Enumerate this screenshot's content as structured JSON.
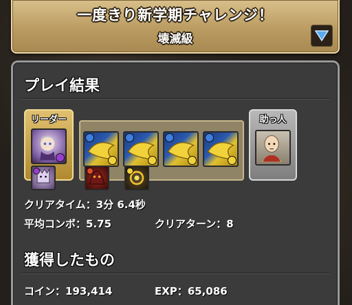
{
  "header": {
    "title": "一度きり新学期チャレンジ！",
    "difficulty": "壊滅級"
  },
  "results": {
    "section_title": "プレイ結果",
    "leader_label": "リーダー",
    "helper_label": "助っ人",
    "clear_time_label": "クリアタイム：",
    "clear_time_value": "3分 6.4秒",
    "avg_combo_label": "平均コンボ：",
    "avg_combo_value": "5.75",
    "clear_turns_label": "クリアターン：",
    "clear_turns_value": "8"
  },
  "rewards": {
    "section_title": "獲得したもの",
    "coin_label": "コイン：",
    "coin_value": "193,414",
    "exp_label": "EXP：",
    "exp_value": "65,086"
  },
  "colors": {
    "banner": "#c4a66e",
    "leader_frame": "#d4b050",
    "helper_frame": "#a8a8a8",
    "water_attr": "#3f7fe0",
    "light_attr": "#f2d23a",
    "dark_attr": "#9a3fd0",
    "fire_attr": "#e04a2a"
  },
  "icons": {
    "dropdown": "triangle-down-icon"
  }
}
